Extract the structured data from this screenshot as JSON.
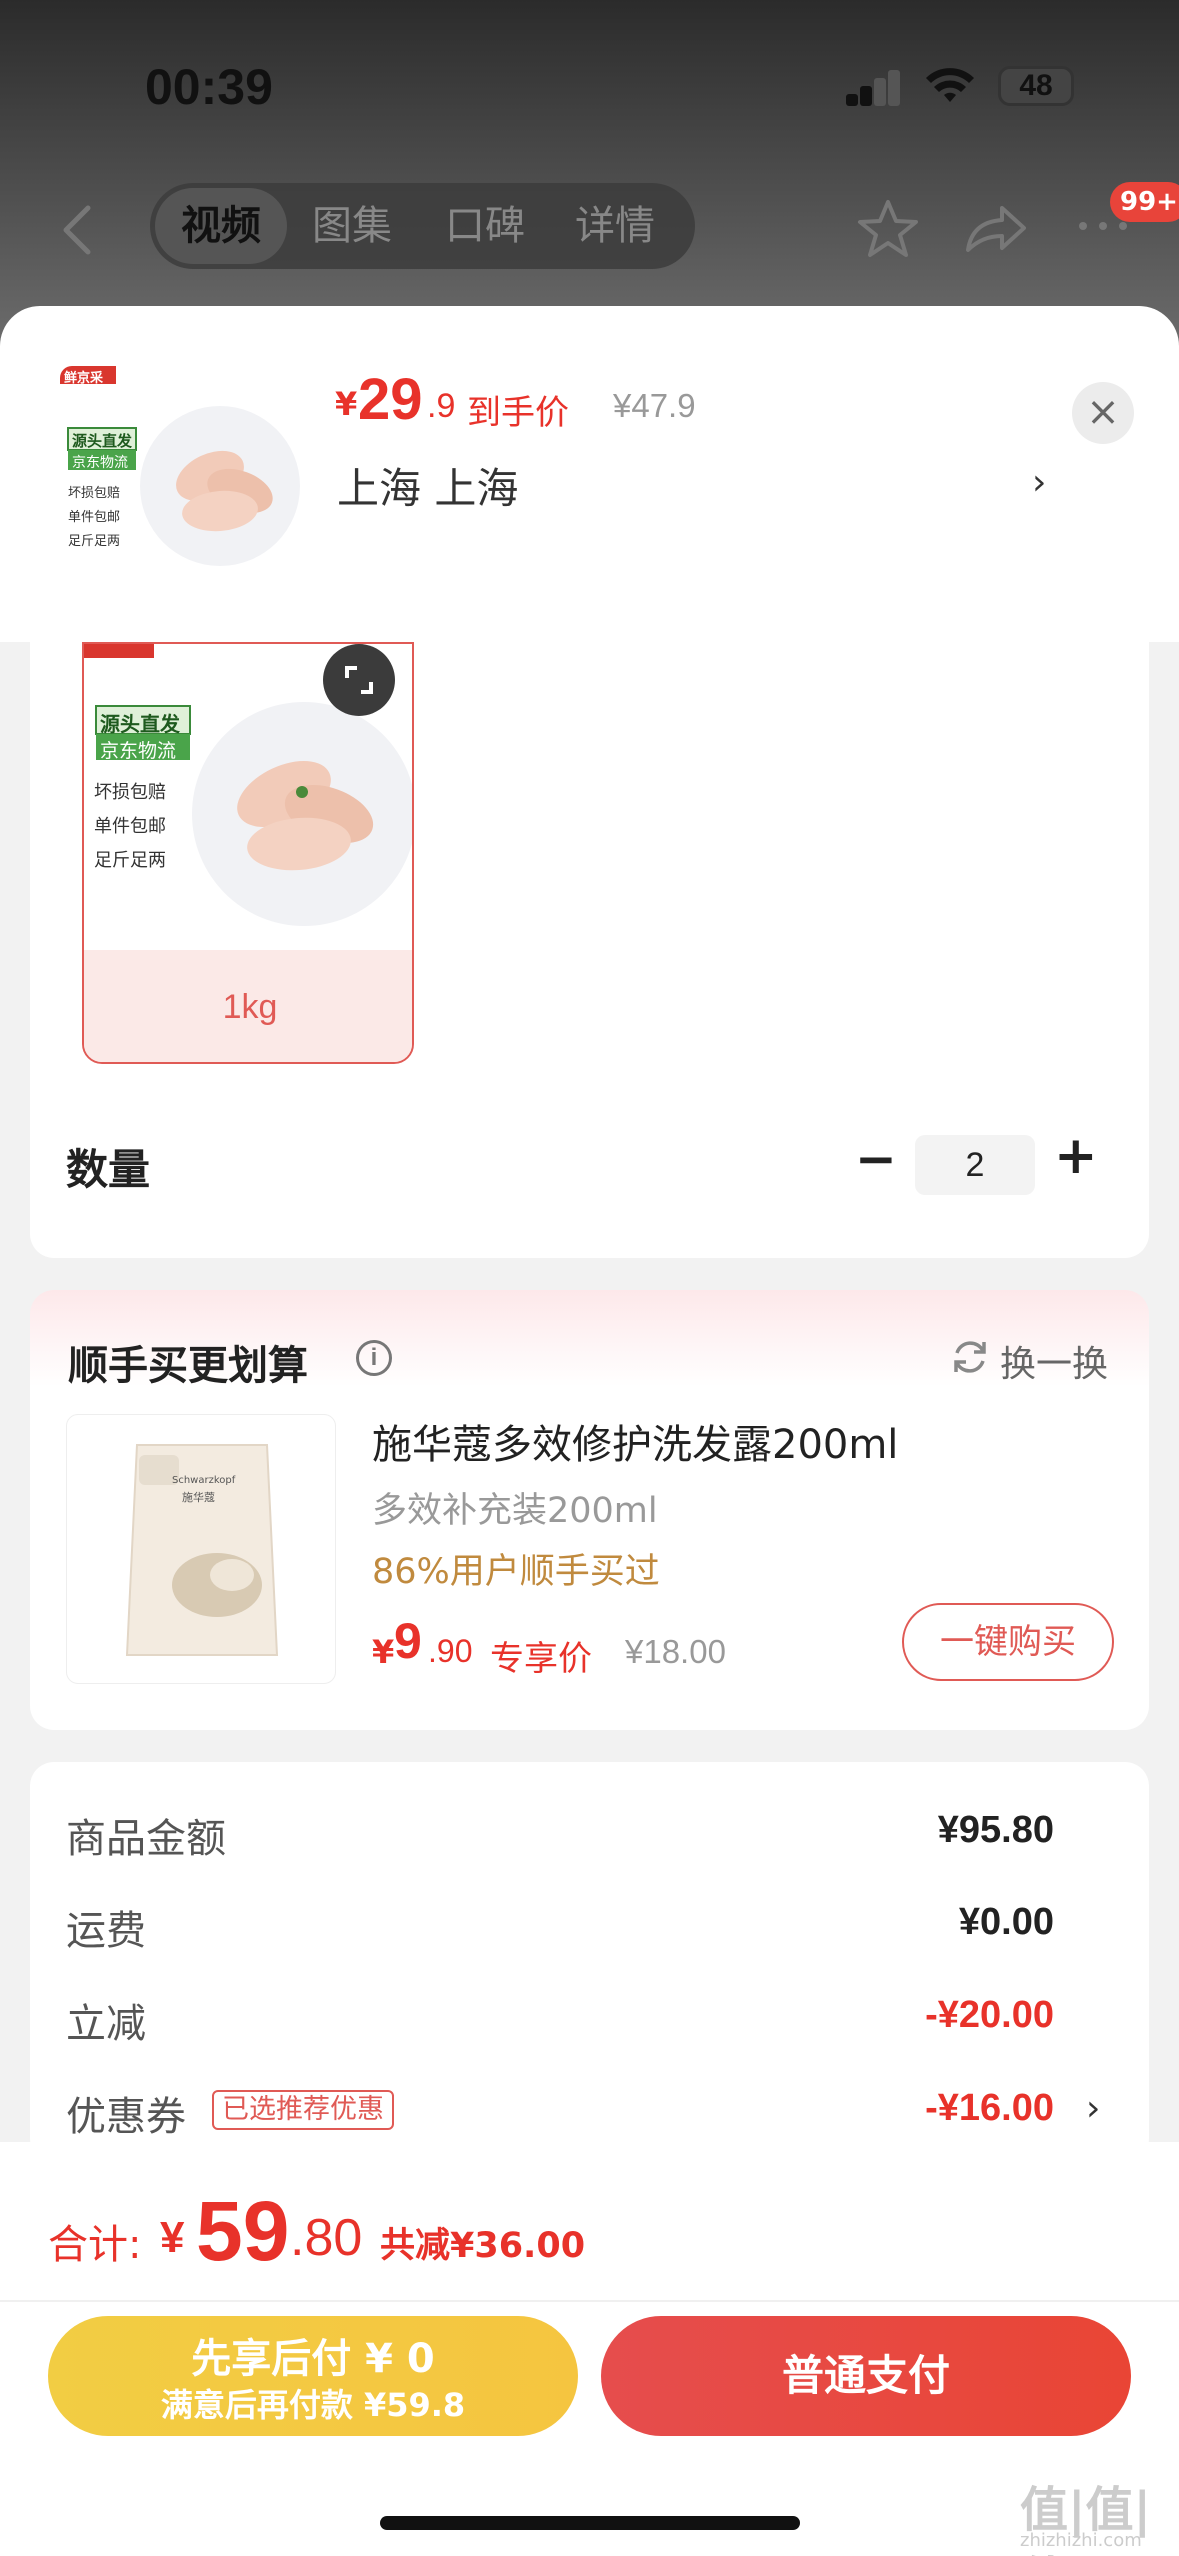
{
  "status_bar": {
    "time": "00:39",
    "battery": "48"
  },
  "nav": {
    "tabs": [
      "视频",
      "图集",
      "口碑",
      "详情"
    ],
    "badge": "99+"
  },
  "product": {
    "thumb_brand": "鲜京采",
    "thumb_tag1": "源头直发",
    "thumb_tag2": "京东物流",
    "thumb_bullets": [
      "坏损包赔",
      "单件包邮",
      "足斤足两"
    ],
    "price_symbol": "¥",
    "price_int": "29",
    "price_dec": ".9",
    "price_label": "到手价",
    "original_price": "¥47.9",
    "region": "上海 上海",
    "close": "×",
    "chevron": "›"
  },
  "sku": {
    "option_label": "1kg",
    "quantity_label": "数量",
    "quantity": "2",
    "minus": "−",
    "plus": "+"
  },
  "addon": {
    "title": "顺手买更划算",
    "info": "i",
    "refresh_label": "换一换",
    "name": "施华蔻多效修护洗发露200ml",
    "spec": "多效补充装200ml",
    "percent_text": "86%用户顺手买过",
    "price_symbol": "¥",
    "price_int": "9",
    "price_dec": ".90",
    "price_label": "专享价",
    "original_price": "¥18.00",
    "buy_button": "一键购买",
    "pack_brand": "Schwarzkopf",
    "pack_cn": "施华蔻"
  },
  "summary": {
    "rows": [
      {
        "label": "商品金额",
        "value": "¥95.80"
      },
      {
        "label": "运费",
        "value": "¥0.00"
      },
      {
        "label": "立减",
        "value": "-¥20.00"
      },
      {
        "label": "优惠券",
        "value": "-¥16.00"
      }
    ],
    "coupon_tag": "已选推荐优惠",
    "chevron": "›"
  },
  "footer": {
    "total_label": "合计:",
    "total_symbol": "¥",
    "total_int": "59",
    "total_dec": ".80",
    "total_save": "共减¥36.00",
    "paylater_line1": "先享后付 ¥ 0",
    "paylater_line2": "满意后再付款 ¥59.8",
    "pay_button": "普通支付"
  },
  "watermark": {
    "main": "值|值|值",
    "sub": "zhizhizhi.com"
  },
  "colors": {
    "accent": "#e8322a",
    "gold": "#f2cd43",
    "amber_text": "#c08a3e"
  }
}
